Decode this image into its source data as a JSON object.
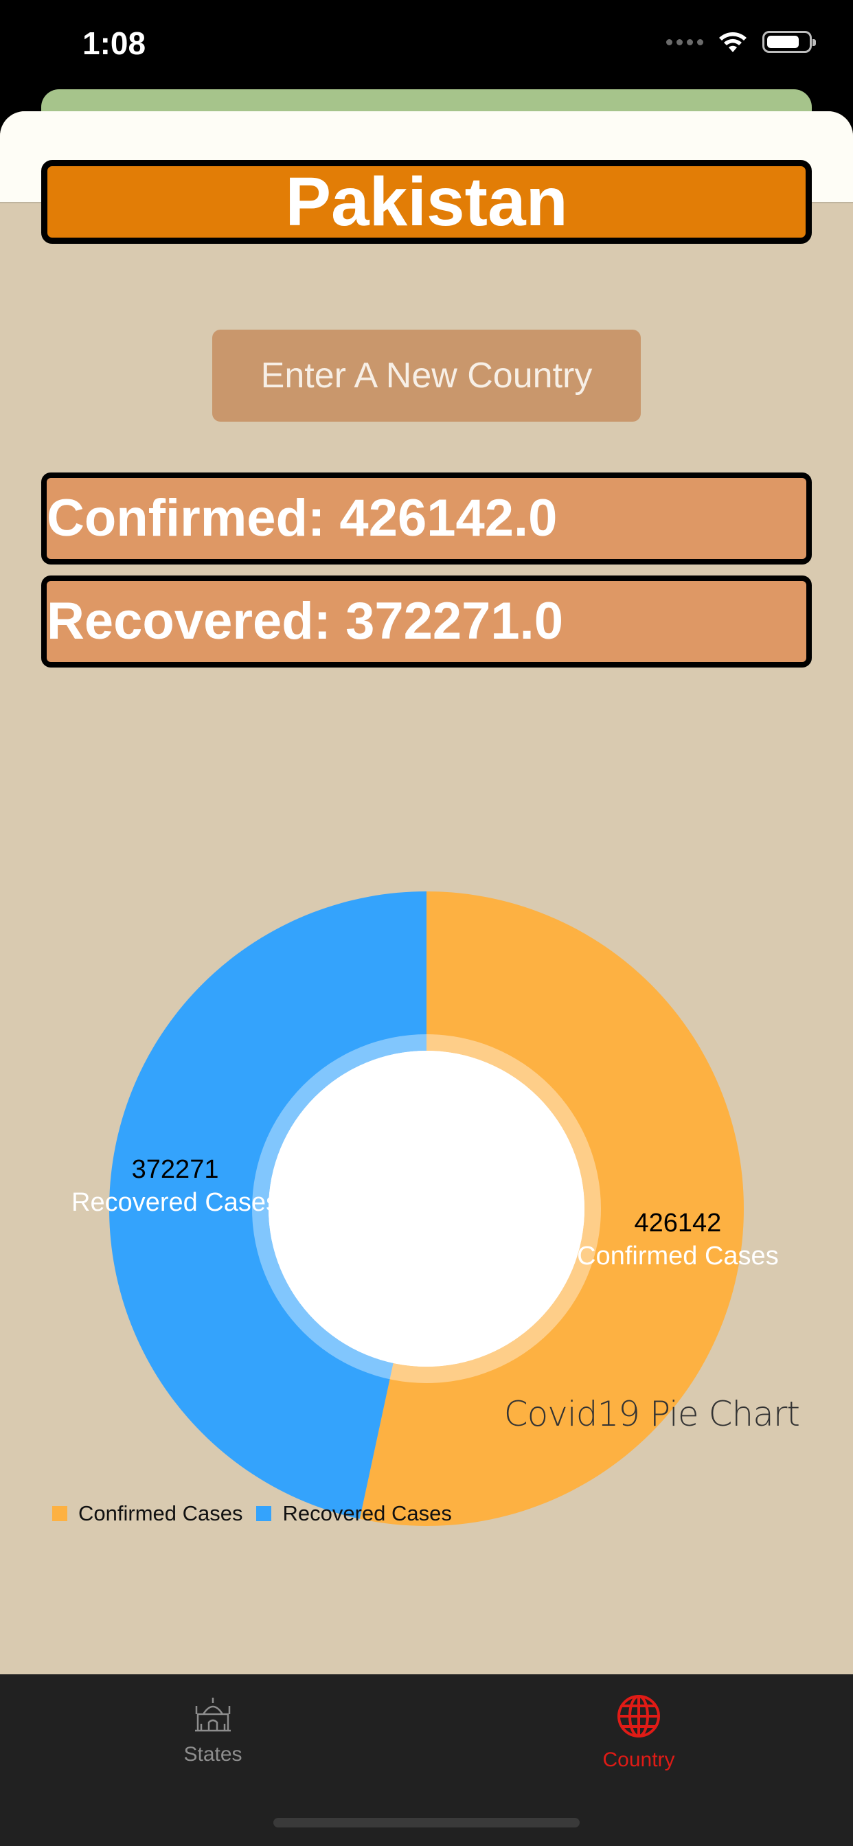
{
  "status_bar": {
    "time": "1:08"
  },
  "country": {
    "name": "Pakistan"
  },
  "buttons": {
    "new_country": "Enter A New Country"
  },
  "stats": {
    "confirmed": "Confirmed: 426142.0",
    "recovered": "Recovered: 372271.0"
  },
  "chart_data": {
    "type": "pie",
    "categories": [
      "Confirmed Cases",
      "Recovered Cases"
    ],
    "values": [
      426142,
      372271
    ],
    "colors": [
      "#fdb142",
      "#34a3fc"
    ],
    "value_labels": [
      "426142",
      "372271"
    ],
    "title": "Covid19 Pie Chart",
    "legend": "bottom-left",
    "hole": true
  },
  "tabs": [
    {
      "label": "States",
      "icon": "building-icon",
      "selected": false
    },
    {
      "label": "Country",
      "icon": "globe-icon",
      "selected": true
    }
  ],
  "colors": {
    "accent": "#e01b16",
    "title_bg": "#e27d06",
    "stat_bg": "#de9865",
    "page_bg": "#d9cab0"
  }
}
